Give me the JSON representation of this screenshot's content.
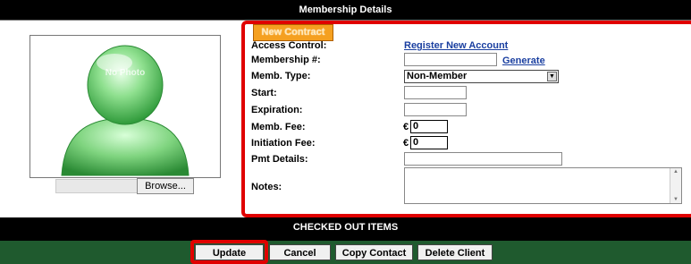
{
  "header": {
    "title": "Membership Details"
  },
  "photo": {
    "placeholder_text": "No Photo",
    "browse_label": "Browse..."
  },
  "form": {
    "new_contract_label": "New Contract",
    "access_control_label": "Access Control:",
    "register_link": "Register New Account",
    "membership_num_label": "Membership #:",
    "membership_num_value": "",
    "generate_link": "Generate",
    "memb_type_label": "Memb. Type:",
    "memb_type_value": "Non-Member",
    "start_label": "Start:",
    "expiration_label": "Expiration:",
    "memb_fee_label": "Memb. Fee:",
    "memb_fee_currency": "€",
    "memb_fee_value": "0",
    "initiation_fee_label": "Initiation Fee:",
    "initiation_fee_currency": "€",
    "initiation_fee_value": "0",
    "pmt_details_label": "Pmt Details:",
    "notes_label": "Notes:"
  },
  "section2": {
    "title": "CHECKED OUT ITEMS"
  },
  "actions": {
    "update": "Update",
    "cancel": "Cancel",
    "copy_contact": "Copy Contact",
    "delete_client": "Delete Client"
  },
  "colors": {
    "highlight": "#e00000",
    "header_bg": "#000000",
    "footer_bg": "#1f5a2e",
    "accent_button": "#f5a020",
    "link": "#1a3fa0"
  }
}
